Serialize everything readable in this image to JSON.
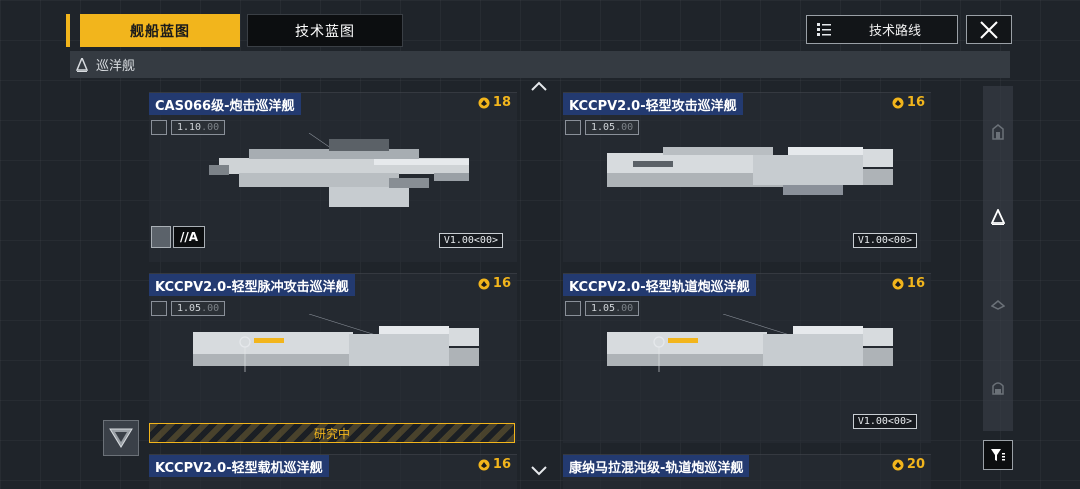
{
  "tabs": [
    {
      "label": "舰船蓝图",
      "active": true
    },
    {
      "label": "技术蓝图",
      "active": false
    }
  ],
  "header": {
    "tech_route_label": "技术路线",
    "close_icon": "close-icon"
  },
  "category": {
    "label": "巡洋舰",
    "icon": "cruiser-icon"
  },
  "cards": [
    {
      "title": "CAS066级-炮击巡洋舰",
      "cost": "18",
      "version": "1.10",
      "version_suffix": ".00",
      "tag": "V1.00<00>",
      "grade": "//A",
      "status": ""
    },
    {
      "title": "KCCPV2.0-轻型攻击巡洋舰",
      "cost": "16",
      "version": "1.05",
      "version_suffix": ".00",
      "tag": "V1.00<00>",
      "status": ""
    },
    {
      "title": "KCCPV2.0-轻型脉冲攻击巡洋舰",
      "cost": "16",
      "version": "1.05",
      "version_suffix": ".00",
      "tag": "",
      "status": "研究中"
    },
    {
      "title": "KCCPV2.0-轻型轨道炮巡洋舰",
      "cost": "16",
      "version": "1.05",
      "version_suffix": ".00",
      "tag": "V1.00<00>",
      "status": ""
    },
    {
      "title": "KCCPV2.0-轻型载机巡洋舰",
      "cost": "16"
    },
    {
      "title": "康纳马拉混沌级-轨道炮巡洋舰",
      "cost": "20"
    }
  ],
  "colors": {
    "accent": "#f2b51c",
    "title_bg": "#233a70",
    "background": "#1f242a"
  }
}
